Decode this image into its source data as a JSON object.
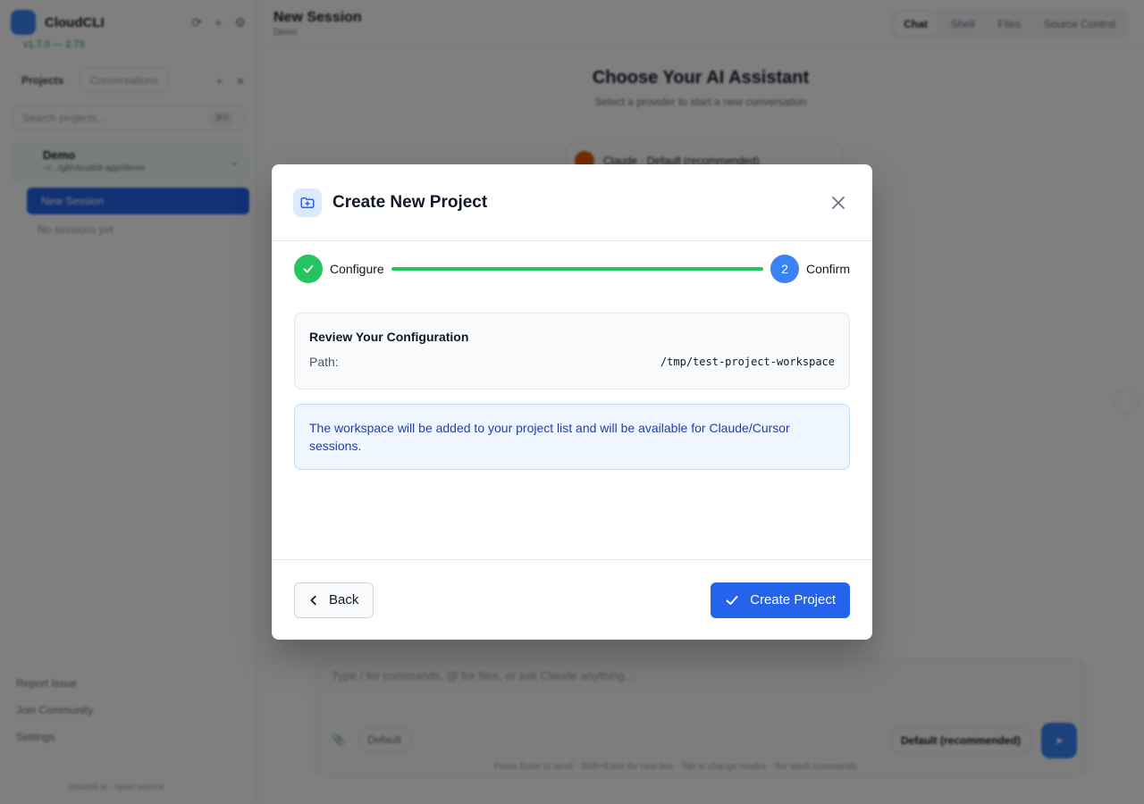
{
  "background": {
    "sidebar": {
      "brand": "CloudCLI",
      "version": "v1.7.0 — 2.73",
      "tabs": [
        "Projects",
        "Conversations"
      ],
      "search_placeholder": "Search projects...",
      "search_kbd": "⌘K",
      "project": {
        "name": "Demo",
        "path": "~/.../git/cloudcli-app/demo"
      },
      "new_session": "New Session",
      "no_sessions": "No sessions yet",
      "bottom_links": [
        "Report Issue",
        "Join Community",
        "Settings"
      ],
      "footer": "cloudcli.ai · open source"
    },
    "main": {
      "title": "New Session",
      "subtitle": "Demo",
      "top_tabs": [
        "Chat",
        "Shell",
        "Files",
        "Source Control"
      ],
      "choose_title": "Choose Your AI Assistant",
      "choose_subtitle": "Select a provider to start a new conversation",
      "provider": "Claude · Default (recommended)",
      "composer_placeholder": "Type / for commands, @ for files, or ask Claude anything...",
      "composer_mode": "Default",
      "composer_model": "Default (recommended)",
      "composer_hint": "Press Enter to send · Shift+Enter for new line · Tab to change modes · /for slash commands"
    }
  },
  "modal": {
    "title": "Create New Project",
    "steps": [
      {
        "label": "Configure",
        "state": "done"
      },
      {
        "label": "Confirm",
        "number": "2",
        "state": "current"
      }
    ],
    "review": {
      "title": "Review Your Configuration",
      "path_label": "Path:",
      "path_value": "/tmp/test-project-workspace"
    },
    "info_text": "The workspace will be added to your project list and will be available for Claude/Cursor sessions.",
    "back_label": "Back",
    "create_label": "Create Project"
  },
  "colors": {
    "primary": "#2563eb",
    "success": "#22c55e",
    "info_bg": "#eff6ff",
    "info_text": "#1e40af"
  }
}
